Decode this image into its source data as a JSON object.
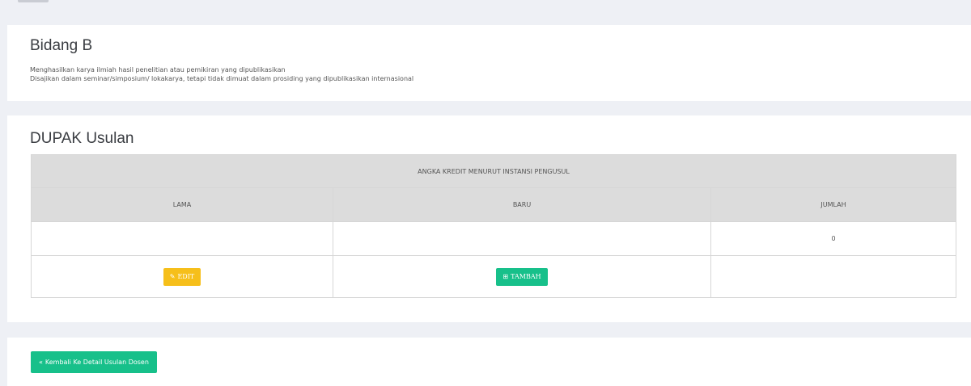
{
  "card_bidang": {
    "title": "Bidang B",
    "desc_line1": "Menghasilkan karya ilmiah hasil penelitian atau pemikiran yang dipublikasikan",
    "desc_line2": "Disajikan dalam seminar/simposium/ lokakarya, tetapi tidak dimuat dalam prosiding yang dipublikasikan internasional"
  },
  "card_dupak": {
    "title": "DUPAK Usulan",
    "table": {
      "group_header": "ANGKA KREDIT MENURUT INSTANSI PENGUSUL",
      "columns": [
        "LAMA",
        "BARU",
        "JUMLAH"
      ],
      "row_values": [
        "",
        "",
        "0"
      ],
      "edit_label": "EDIT",
      "tambah_label": "TAMBAH"
    }
  },
  "footer_card": {
    "back_label": "Kembali Ke Detail Usulan Dosen"
  },
  "icons": {
    "edit": "edit-icon",
    "tambah": "plus-square-icon",
    "back": "angle-double-left-icon"
  },
  "colors": {
    "page_bg": "#eef0f5",
    "table_header_bg": "#dcdcdc",
    "edit_button": "#f6bf1a",
    "success_button": "#17c08a"
  }
}
